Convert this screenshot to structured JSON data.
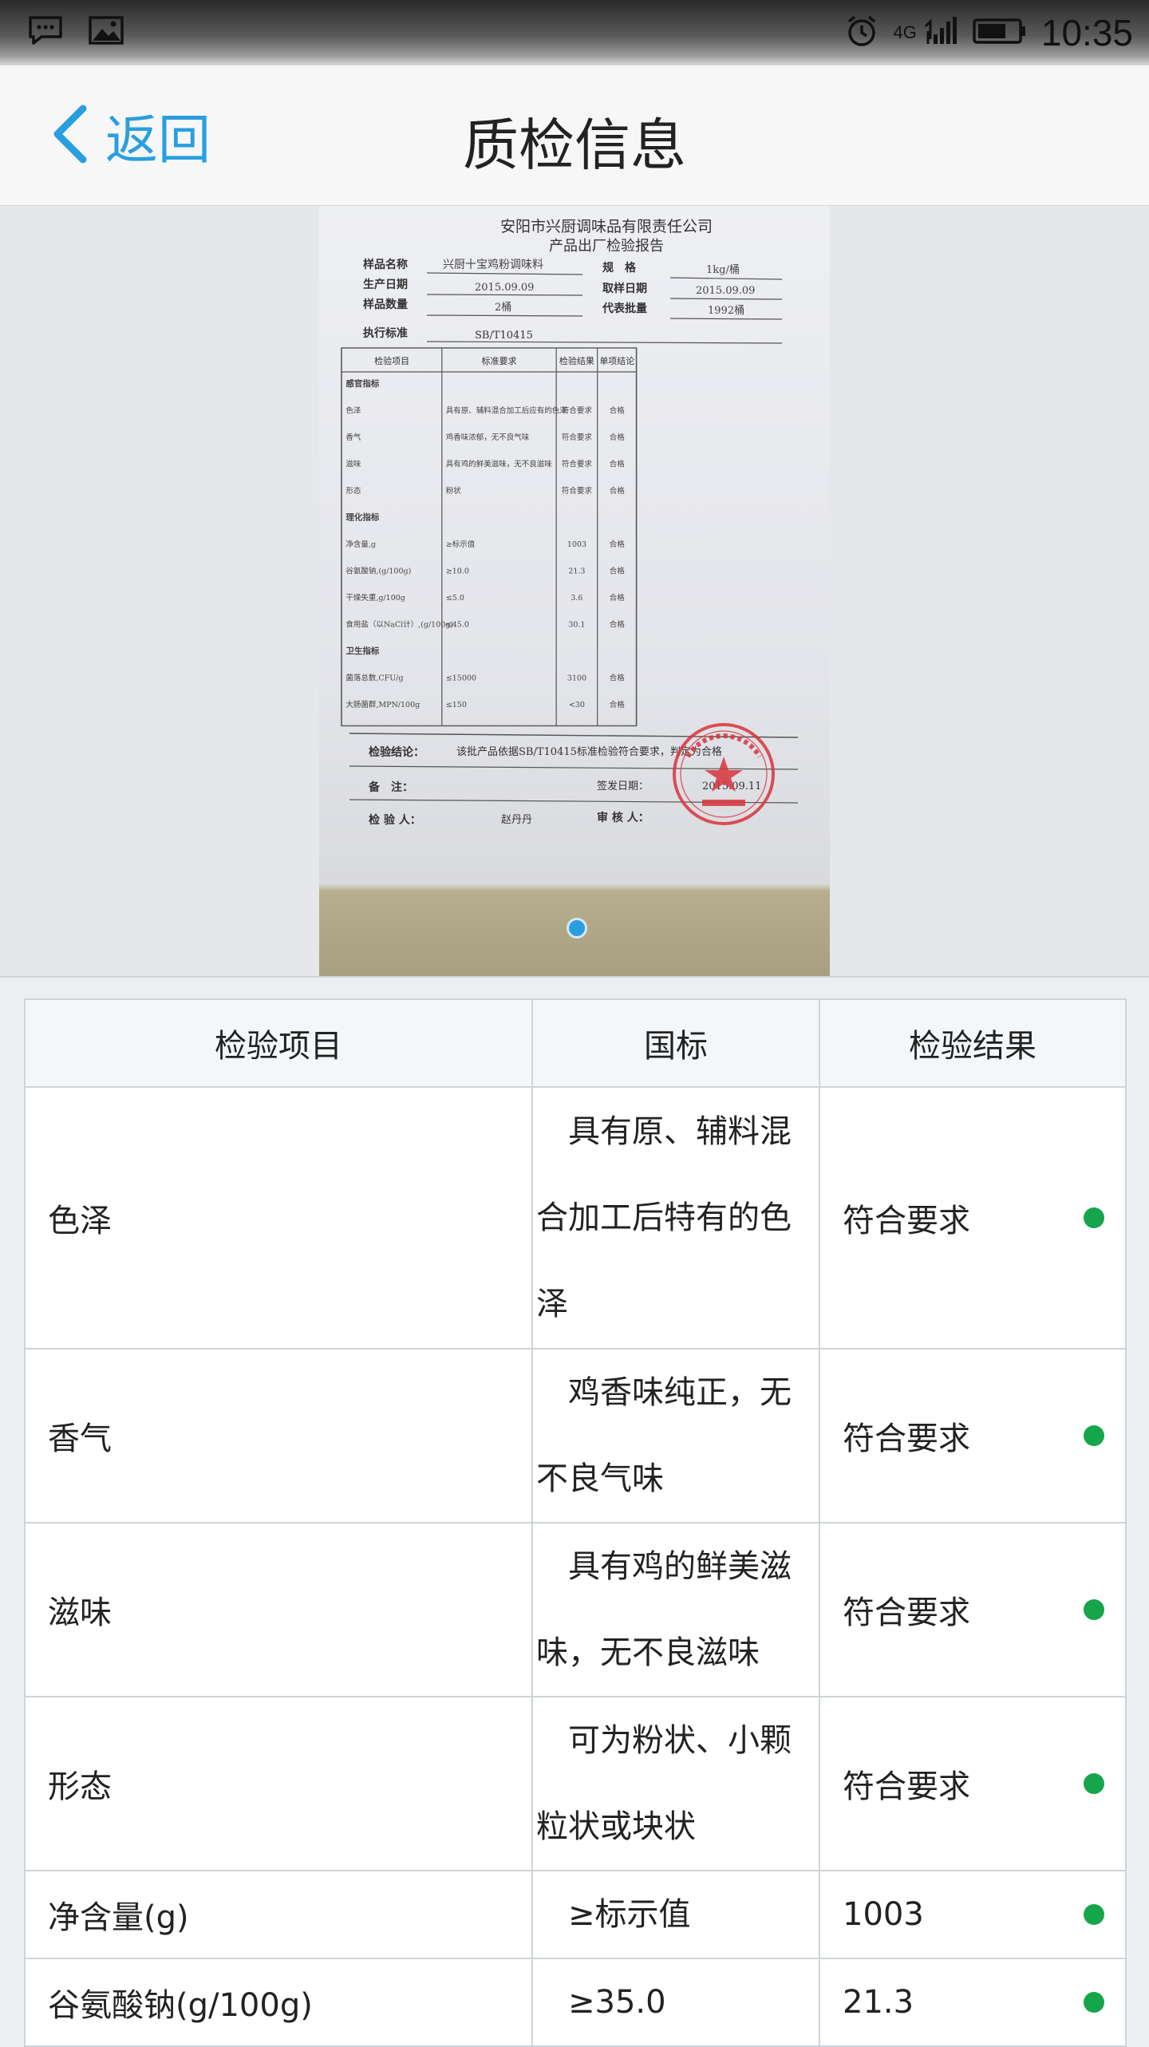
{
  "status_bar": {
    "time": "10:35",
    "network": "4G",
    "icons": [
      "message-icon",
      "image-icon",
      "alarm-icon",
      "signal-icon",
      "battery-icon"
    ]
  },
  "nav": {
    "back_label": "返回",
    "title": "质检信息"
  },
  "carousel": {
    "image_description": "检验报告照片",
    "active_index": 1,
    "total": 1,
    "report": {
      "company": "安阳市兴厨调味品有限责任公司",
      "title": "产品出厂检验报告",
      "sample_name_label": "样品名称",
      "sample_name": "兴厨十宝鸡粉调味料",
      "spec_label": "规　格",
      "spec": "1kg/桶",
      "prod_date_label": "生产日期",
      "prod_date": "2015.09.09",
      "sample_date_label": "取样日期",
      "sample_date": "2015.09.09",
      "qty_label": "样品数量",
      "qty": "2桶",
      "batch_label": "代表批量",
      "batch": "1992桶",
      "standard_label": "执行标准",
      "standard": "SB/T10415",
      "headers": [
        "检验项目",
        "标准要求",
        "检验结果",
        "单项结论"
      ],
      "rows": [
        [
          "感官指标",
          "",
          "",
          ""
        ],
        [
          "色泽",
          "具有原、辅料混合加工后应有的色泽",
          "符合要求",
          "合格"
        ],
        [
          "香气",
          "鸡香味浓郁，无不良气味",
          "符合要求",
          "合格"
        ],
        [
          "滋味",
          "具有鸡的鲜美滋味，无不良滋味",
          "符合要求",
          "合格"
        ],
        [
          "形态",
          "粉状",
          "符合要求",
          "合格"
        ],
        [
          "理化指标",
          "",
          "",
          ""
        ],
        [
          "净含量,g",
          "≥标示值",
          "1003",
          "合格"
        ],
        [
          "谷氨酸钠,(g/100g)",
          "≥10.0",
          "21.3",
          "合格"
        ],
        [
          "干燥失重,g/100g",
          "≤5.0",
          "3.6",
          "合格"
        ],
        [
          "食用盐（以NaCl计）,(g/100g)",
          "≤45.0",
          "30.1",
          "合格"
        ],
        [
          "卫生指标",
          "",
          "",
          ""
        ],
        [
          "菌落总数,CFU/g",
          "≤15000",
          "3100",
          "合格"
        ],
        [
          "大肠菌群,MPN/100g",
          "≤150",
          "<30",
          "合格"
        ]
      ],
      "conclusion_label": "检验结论：",
      "conclusion": "该批产品依据SB/T10415标准检验符合要求，判定为合格",
      "remark_label": "备　注：",
      "issue_date_label": "签发日期：",
      "issue_date": "2015.09.11",
      "inspector_label": "检 验 人：",
      "inspector": "赵丹丹",
      "reviewer_label": "审 核 人："
    }
  },
  "table": {
    "headers": [
      "检验项目",
      "国标",
      "检验结果"
    ],
    "rows": [
      {
        "item": "色泽",
        "standard": "具有原、辅料混合加工后特有的色泽",
        "result": "符合要求"
      },
      {
        "item": "香气",
        "standard": "鸡香味纯正，无不良气味",
        "result": "符合要求"
      },
      {
        "item": "滋味",
        "standard": "具有鸡的鲜美滋味，无不良滋味",
        "result": "符合要求"
      },
      {
        "item": "形态",
        "standard": "可为粉状、小颗粒状或块状",
        "result": "符合要求"
      },
      {
        "item": "净含量(g)",
        "standard": "≥标示值",
        "result": "1003"
      },
      {
        "item": "谷氨酸钠(g/100g)",
        "standard": "≥35.0",
        "result": "21.3"
      }
    ],
    "status_color": "#15a64b"
  },
  "colors": {
    "accent": "#2a9fe0",
    "stamp": "#d8343c"
  }
}
